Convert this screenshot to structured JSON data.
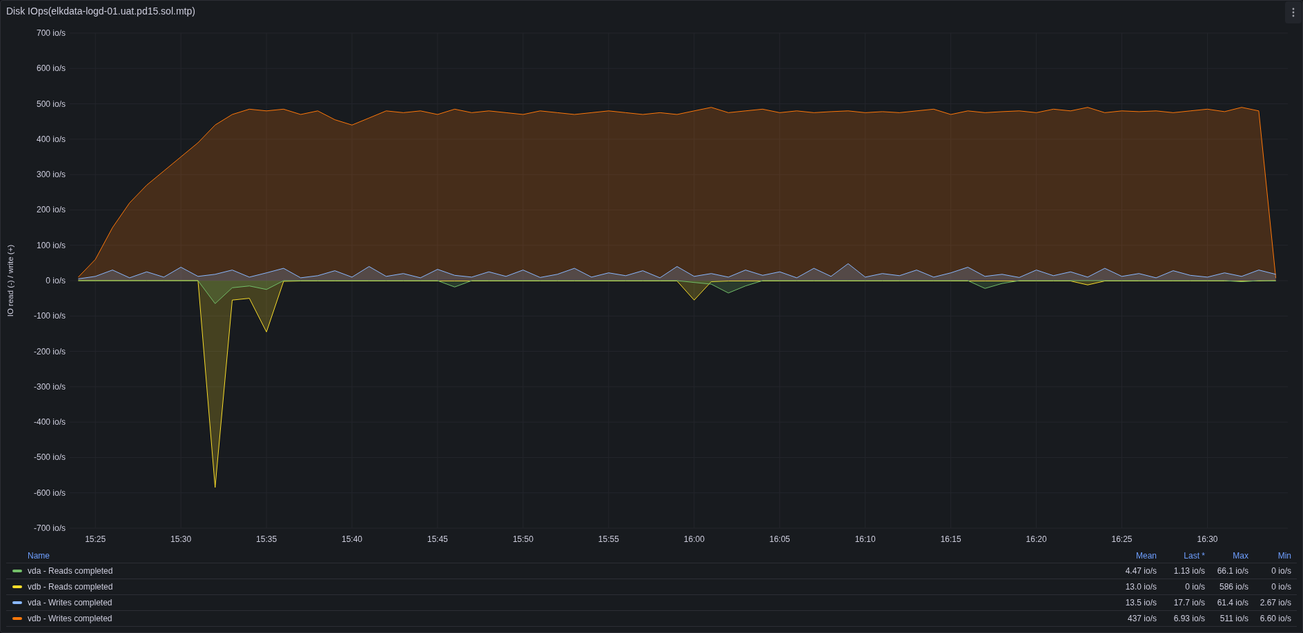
{
  "panel": {
    "title": "Disk IOps(elkdata-logd-01.uat.pd15.sol.mtp)",
    "chart_data": {
      "type": "area",
      "grid": true,
      "ylabel": "IO read (-) / write (+)",
      "ylim": [
        -700,
        700
      ],
      "categories": [
        null,
        "15:25",
        null,
        null,
        null,
        null,
        "15:30",
        null,
        null,
        null,
        null,
        "15:35",
        null,
        null,
        null,
        null,
        "15:40",
        null,
        null,
        null,
        null,
        "15:45",
        null,
        null,
        null,
        null,
        "15:50",
        null,
        null,
        null,
        null,
        "15:55",
        null,
        null,
        null,
        null,
        "16:00",
        null,
        null,
        null,
        null,
        "16:05",
        null,
        null,
        null,
        null,
        "16:10",
        null,
        null,
        null,
        null,
        "16:15",
        null,
        null,
        null,
        null,
        "16:20",
        null,
        null,
        null,
        null,
        "16:25",
        null,
        null,
        null,
        null,
        "16:30",
        null,
        null,
        null,
        null
      ],
      "yticks": [
        {
          "value": 700,
          "label": "700 io/s"
        },
        {
          "value": 600,
          "label": "600 io/s"
        },
        {
          "value": 500,
          "label": "500 io/s"
        },
        {
          "value": 400,
          "label": "400 io/s"
        },
        {
          "value": 300,
          "label": "300 io/s"
        },
        {
          "value": 200,
          "label": "200 io/s"
        },
        {
          "value": 100,
          "label": "100 io/s"
        },
        {
          "value": 0,
          "label": "0 io/s"
        },
        {
          "value": -100,
          "label": "-100 io/s"
        },
        {
          "value": -200,
          "label": "-200 io/s"
        },
        {
          "value": -300,
          "label": "-300 io/s"
        },
        {
          "value": -400,
          "label": "-400 io/s"
        },
        {
          "value": -500,
          "label": "-500 io/s"
        },
        {
          "value": -600,
          "label": "-600 io/s"
        },
        {
          "value": -700,
          "label": "-700 io/s"
        }
      ],
      "series": [
        {
          "color": "#ff780a",
          "values": [
            10,
            60,
            150,
            220,
            270,
            310,
            350,
            390,
            440,
            470,
            485,
            480,
            485,
            470,
            480,
            455,
            440,
            460,
            480,
            475,
            480,
            470,
            485,
            475,
            480,
            475,
            470,
            480,
            475,
            470,
            475,
            480,
            475,
            470,
            475,
            470,
            480,
            490,
            475,
            480,
            485,
            475,
            480,
            475,
            478,
            480,
            475,
            478,
            475,
            480,
            485,
            470,
            480,
            475,
            478,
            480,
            475,
            485,
            480,
            490,
            475,
            480,
            478,
            480,
            475,
            480,
            485,
            478,
            490,
            480,
            7
          ]
        },
        {
          "color": "#8ab8ff",
          "values": [
            5,
            12,
            30,
            8,
            25,
            10,
            38,
            12,
            18,
            30,
            10,
            22,
            35,
            8,
            14,
            28,
            10,
            40,
            12,
            20,
            8,
            32,
            15,
            10,
            25,
            12,
            30,
            9,
            18,
            35,
            10,
            22,
            14,
            28,
            8,
            40,
            12,
            20,
            10,
            30,
            15,
            25,
            8,
            35,
            12,
            48,
            10,
            20,
            14,
            30,
            10,
            22,
            38,
            12,
            18,
            9,
            30,
            14,
            25,
            10,
            35,
            12,
            20,
            8,
            28,
            15,
            10,
            22,
            12,
            30,
            18
          ]
        },
        {
          "color": "#fade2a",
          "values": [
            0,
            0,
            0,
            0,
            0,
            0,
            0,
            0,
            -585,
            -55,
            -50,
            -145,
            -2,
            -1,
            -1,
            -1,
            -1,
            -1,
            -1,
            -1,
            -1,
            -1,
            -1,
            -1,
            -1,
            -1,
            -1,
            -1,
            -1,
            -1,
            -1,
            -1,
            -1,
            -1,
            -1,
            -1,
            -55,
            -3,
            -1,
            -1,
            -1,
            -1,
            -1,
            -1,
            -1,
            -1,
            -1,
            -1,
            -1,
            -1,
            -1,
            -1,
            -1,
            -1,
            -1,
            -1,
            -1,
            -1,
            -1,
            -12,
            -1,
            -1,
            -1,
            -1,
            -1,
            -1,
            -1,
            -1,
            -1,
            -1,
            0
          ]
        },
        {
          "color": "#73bf69",
          "values": [
            0,
            0,
            0,
            0,
            0,
            0,
            0,
            0,
            -65,
            -20,
            -15,
            -25,
            0,
            0,
            0,
            0,
            0,
            0,
            0,
            0,
            0,
            0,
            -18,
            0,
            0,
            0,
            0,
            0,
            0,
            0,
            0,
            0,
            0,
            0,
            0,
            0,
            -5,
            -10,
            -35,
            -15,
            0,
            0,
            0,
            0,
            0,
            0,
            0,
            0,
            0,
            0,
            0,
            0,
            0,
            -22,
            -8,
            0,
            0,
            0,
            0,
            0,
            0,
            0,
            0,
            0,
            0,
            0,
            0,
            0,
            -3,
            0,
            -1
          ]
        }
      ]
    }
  },
  "legend": {
    "columns": [
      "Name",
      "Mean",
      "Last *",
      "Max",
      "Min"
    ],
    "rows": [
      {
        "name": "vda - Reads completed",
        "color": "#73bf69",
        "mean": "4.47 io/s",
        "last": "1.13 io/s",
        "max": "66.1 io/s",
        "min": "0 io/s"
      },
      {
        "name": "vdb - Reads completed",
        "color": "#fade2a",
        "mean": "13.0 io/s",
        "last": "0 io/s",
        "max": "586 io/s",
        "min": "0 io/s"
      },
      {
        "name": "vda - Writes completed",
        "color": "#8ab8ff",
        "mean": "13.5 io/s",
        "last": "17.7 io/s",
        "max": "61.4 io/s",
        "min": "2.67 io/s"
      },
      {
        "name": "vdb - Writes completed",
        "color": "#ff780a",
        "mean": "437 io/s",
        "last": "6.93 io/s",
        "max": "511 io/s",
        "min": "6.60 io/s"
      }
    ]
  }
}
